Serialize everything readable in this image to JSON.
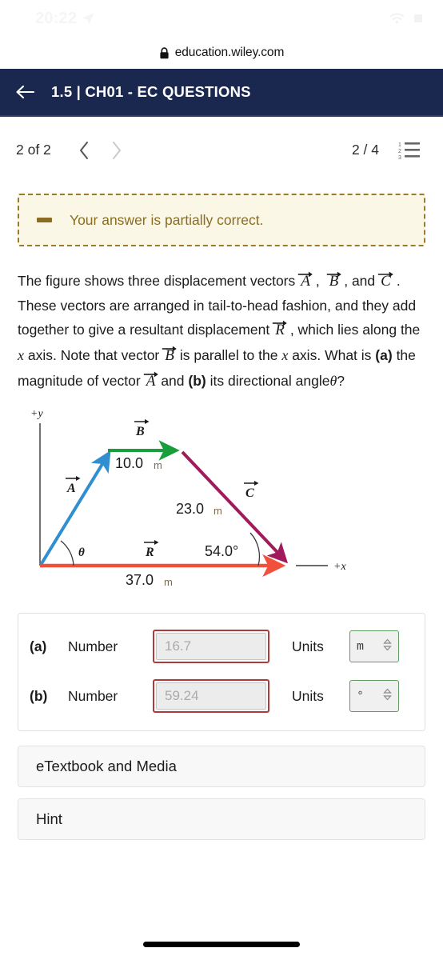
{
  "status_bar": {
    "time": "20:22",
    "location_icon": "location-arrow-icon",
    "wifi_icon": "wifi-icon",
    "battery_icon": "battery-icon"
  },
  "browser": {
    "lock_icon": "lock-icon",
    "url": "education.wiley.com"
  },
  "header": {
    "back_icon": "back-arrow-icon",
    "title": "1.5 | CH01 - EC QUESTIONS",
    "background": "#1a2850"
  },
  "pagination": {
    "page_count": "2 of 2",
    "prev_icon": "chevron-left-icon",
    "next_icon": "chevron-right-icon",
    "question_count": "2 / 4",
    "list_icon": "numbered-list-icon"
  },
  "feedback": {
    "icon": "partial-dash-icon",
    "text": "Your answer is partially correct.",
    "background": "#faf7e6",
    "border_color": "#9c7a2c",
    "text_color": "#8a6d23"
  },
  "question": {
    "line1_a": "The figure shows three displacement vectors",
    "vec_A": "A",
    "line1_b": ",",
    "vec_B": "B",
    "line2_a": ", and",
    "vec_C": "C",
    "line2_b": ". These vectors are arranged in tail-to-head fashion, and they add together to give a resultant displacement",
    "vec_R": "R",
    "line3": ", which lies along the",
    "x_italic": "x",
    "line4": "axis. Note that vector",
    "line5": "is parallel to the",
    "line6": "axis.",
    "line7_a": "What is",
    "label_a": "(a)",
    "line7_b": "the magnitude of vector",
    "line7_c": "and",
    "label_b": "(b)",
    "line7_d": "its directional angle",
    "theta": "θ",
    "line7_e": "?"
  },
  "figure": {
    "axis_y_label": "+y",
    "axis_x_label": "+x",
    "vectors": [
      {
        "name": "A",
        "label": "A",
        "color": "#2f8fd0",
        "magnitude_label": "",
        "description": "blue vector from origin up-right"
      },
      {
        "name": "B",
        "label": "B",
        "color": "#1a9e3c",
        "magnitude_label": "10.0",
        "unit": "m",
        "description": "green horizontal vector"
      },
      {
        "name": "C",
        "label": "C",
        "color": "#a01a5c",
        "magnitude_label": "23.0",
        "unit": "m",
        "description": "magenta vector down-right"
      },
      {
        "name": "R",
        "label": "R",
        "color": "#f0503c",
        "magnitude_label": "37.0",
        "unit": "m",
        "description": "red resultant along x axis"
      }
    ],
    "angle_theta": "θ",
    "angle_c": "54.0°"
  },
  "answers": {
    "rows": [
      {
        "label": "(a)",
        "number_label": "Number",
        "value": "16.7",
        "units_label": "Units",
        "unit_value": "m",
        "input_state": "incorrect",
        "unit_state": "correct"
      },
      {
        "label": "(b)",
        "number_label": "Number",
        "value": "59.24",
        "units_label": "Units",
        "unit_value": "°",
        "input_state": "incorrect",
        "unit_state": "correct"
      }
    ],
    "incorrect_border": "#b03a3a",
    "correct_border": "#5f9c5f"
  },
  "buttons": {
    "etextbook": "eTextbook and Media",
    "hint": "Hint"
  }
}
